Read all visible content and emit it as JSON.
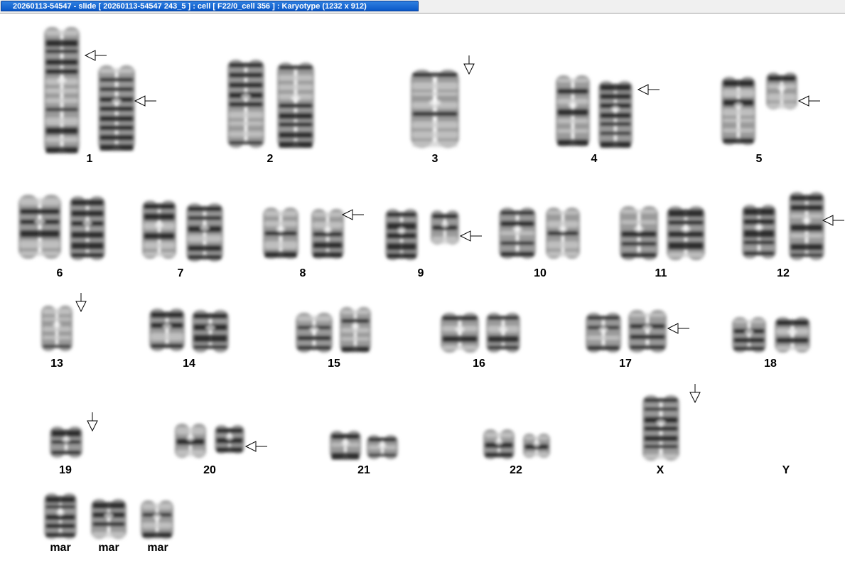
{
  "window": {
    "title": "20260113-54547 - slide [ 20260113-54547 243_5 ] : cell [ F22/0_cell 356 ] : Karyotype  (1232 x 912)"
  },
  "karyotype": {
    "groups": [
      {
        "label": "1",
        "chromosomes": 2,
        "arrows": [
          "left",
          "left"
        ]
      },
      {
        "label": "2",
        "chromosomes": 2,
        "arrows": []
      },
      {
        "label": "3",
        "chromosomes": 1,
        "arrows": [
          "down"
        ]
      },
      {
        "label": "4",
        "chromosomes": 2,
        "arrows": [
          "left"
        ]
      },
      {
        "label": "5",
        "chromosomes": 2,
        "arrows": [
          "left"
        ]
      },
      {
        "label": "6",
        "chromosomes": 2,
        "arrows": []
      },
      {
        "label": "7",
        "chromosomes": 2,
        "arrows": []
      },
      {
        "label": "8",
        "chromosomes": 2,
        "arrows": [
          "left"
        ]
      },
      {
        "label": "9",
        "chromosomes": 2,
        "arrows": [
          "left"
        ]
      },
      {
        "label": "10",
        "chromosomes": 2,
        "arrows": []
      },
      {
        "label": "11",
        "chromosomes": 2,
        "arrows": []
      },
      {
        "label": "12",
        "chromosomes": 2,
        "arrows": [
          "left"
        ]
      },
      {
        "label": "13",
        "chromosomes": 1,
        "arrows": [
          "down"
        ]
      },
      {
        "label": "14",
        "chromosomes": 2,
        "arrows": []
      },
      {
        "label": "15",
        "chromosomes": 2,
        "arrows": []
      },
      {
        "label": "16",
        "chromosomes": 2,
        "arrows": []
      },
      {
        "label": "17",
        "chromosomes": 2,
        "arrows": [
          "left"
        ]
      },
      {
        "label": "18",
        "chromosomes": 2,
        "arrows": []
      },
      {
        "label": "19",
        "chromosomes": 1,
        "arrows": [
          "down"
        ]
      },
      {
        "label": "20",
        "chromosomes": 2,
        "arrows": [
          "left"
        ]
      },
      {
        "label": "21",
        "chromosomes": 2,
        "arrows": []
      },
      {
        "label": "22",
        "chromosomes": 2,
        "arrows": []
      },
      {
        "label": "X",
        "chromosomes": 1,
        "arrows": [
          "down"
        ]
      },
      {
        "label": "Y",
        "chromosomes": 0,
        "arrows": []
      },
      {
        "label": "mar",
        "chromosomes": 1,
        "arrows": []
      },
      {
        "label": "mar",
        "chromosomes": 1,
        "arrows": []
      },
      {
        "label": "mar",
        "chromosomes": 1,
        "arrows": []
      }
    ]
  },
  "colors": {
    "titlebar_active": "#0a58c8",
    "chromosome_dark": "#1a1a1a",
    "chromosome_light": "#9a9a9a"
  }
}
